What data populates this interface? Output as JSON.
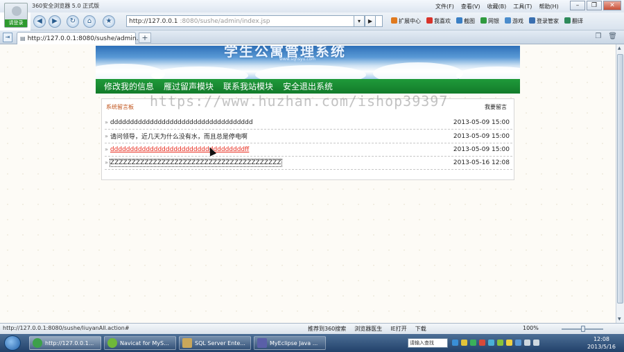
{
  "browser": {
    "title": "360安全浏览器 5.0 正式版",
    "login_label": "请登录",
    "menu": [
      "文件(F)",
      "查看(V)",
      "收藏(B)",
      "工具(T)",
      "帮助(H)"
    ],
    "address_host": "http://127.0.0.1",
    "address_path": ":8080/sushe/admin/index.jsp",
    "toolbar_items": [
      "扩展中心",
      "我喜欢",
      "截图",
      "网银",
      "游戏",
      "登录管家",
      "翻译"
    ],
    "tab_title": "http://127.0.0.1:8080/sushe/admin...",
    "status_url": "http://127.0.0.1:8080/sushe/liuyanAll.action#",
    "status_items": [
      "推荐到360搜索",
      "浏览器医生",
      "IE打开",
      "下载"
    ],
    "zoom": "100%"
  },
  "site": {
    "banner_title": "学生公寓管理系统",
    "banner_url": "www.sqnsyu.com",
    "nav": [
      "修改我的信息",
      "雁过留声模块",
      "联系我站模块",
      "安全退出系统"
    ]
  },
  "panel": {
    "heading": "系统留言板",
    "more": "我要留言",
    "messages": [
      {
        "title": "dddddddddddddddddddddddddddddddddddd",
        "date": "2013-05-09 15:00"
      },
      {
        "title": "请问领导，近几天为什么没有水，而且总是停电啊",
        "date": "2013-05-09 15:00"
      },
      {
        "title": "ddddddddddddddddddddddddddddddddddff",
        "date": "2013-05-09 15:00"
      },
      {
        "title": "ZZZZZZZZZZZZZZZZZZZZZZZZZZZZZZZZZZZZZZZZ",
        "date": "2013-05-16 12:08"
      }
    ]
  },
  "watermark": "https://www.huzhan.com/ishop39397",
  "taskbar": {
    "tasks": [
      "http://127.0.0.1...",
      "Navicat for MyS...",
      "SQL Server Ente...",
      "MyEclipse Java ..."
    ],
    "ime_placeholder": "请输入查找",
    "time": "12:08",
    "date": "2013/5/16"
  }
}
